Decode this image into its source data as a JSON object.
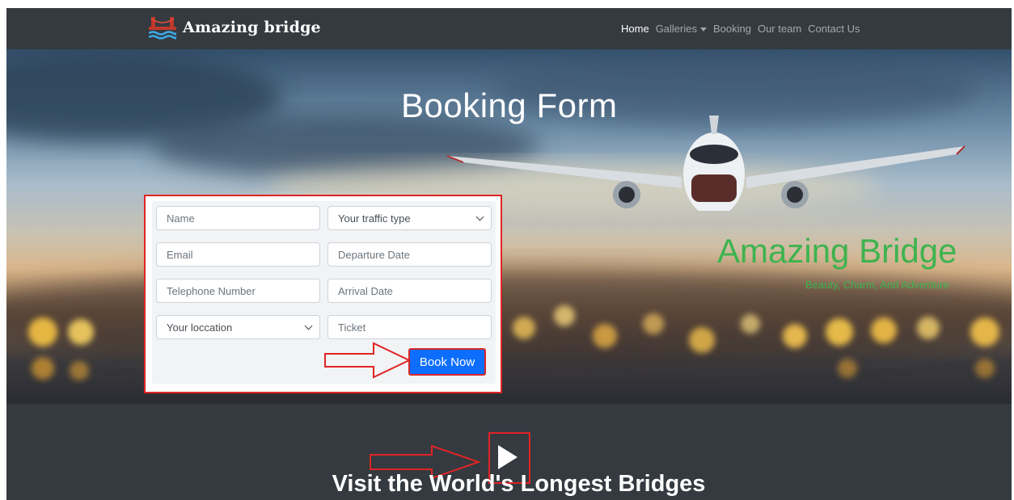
{
  "navbar": {
    "brand": "Amazing bridge",
    "links": [
      {
        "label": "Home",
        "active": true
      },
      {
        "label": "Galleries",
        "dropdown": true
      },
      {
        "label": "Booking"
      },
      {
        "label": "Our team"
      },
      {
        "label": "Contact Us"
      }
    ]
  },
  "hero": {
    "title": "Booking Form",
    "brand_headline": "Amazing Bridge",
    "brand_tagline": "Beauty, Charm, And Adventure"
  },
  "form": {
    "left_fields": [
      {
        "placeholder": "Name"
      },
      {
        "placeholder": "Email"
      },
      {
        "placeholder": "Telephone Number"
      },
      {
        "placeholder": "Your loccation",
        "type": "select"
      }
    ],
    "right_fields": [
      {
        "placeholder": "Your traffic type",
        "type": "select"
      },
      {
        "placeholder": "Departure Date"
      },
      {
        "placeholder": "Arrival Date"
      },
      {
        "placeholder": "Ticket"
      }
    ],
    "submit_label": "Book Now"
  },
  "video": {
    "title": "Visit the World's Longest Bridges",
    "play_icon": "play-icon"
  },
  "colors": {
    "navbar_bg": "#343a40",
    "accent_green": "#3fb34f",
    "button_blue": "#0d6efd",
    "annotation_red": "#e02424"
  }
}
